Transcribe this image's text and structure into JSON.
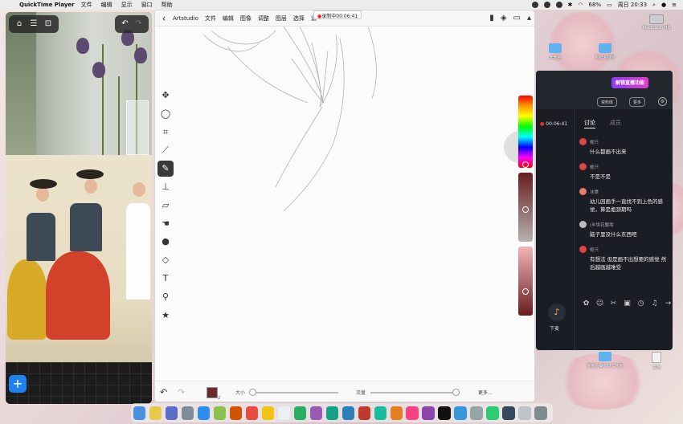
{
  "menubar": {
    "app_name": "QuickTime Player",
    "items": [
      "文件",
      "编辑",
      "显示",
      "窗口",
      "帮助"
    ],
    "battery": "68%",
    "clock": "周日 20:33"
  },
  "desktop": {
    "icons": [
      {
        "label": "Macintosh HD",
        "kind": "drive"
      },
      {
        "label": "未命名",
        "kind": "folder"
      },
      {
        "label": "贴纸素材包",
        "kind": "folder"
      },
      {
        "label": "画画临摹资料文件夹",
        "kind": "folder"
      },
      {
        "label": "文档",
        "kind": "doc"
      }
    ]
  },
  "artstudio": {
    "menu": [
      "Artstudio",
      "文件",
      "编辑",
      "图像",
      "调整",
      "图层",
      "选择",
      "滤"
    ],
    "recording": "录制中00:06:41",
    "brush_size_label": "大小",
    "flow_label": "流量",
    "more_label": "更多...",
    "swatch_number": "2",
    "brush_size_fraction": 0.03,
    "flow_fraction": 0.97,
    "current_color": "#6a2a2c",
    "tools": [
      "move-icon",
      "lasso-icon",
      "crop-icon",
      "eyedropper-icon",
      "brush-icon",
      "stamp-icon",
      "eraser-icon",
      "smudge-icon",
      "blur-icon",
      "fill-icon",
      "text-icon",
      "zoom-icon",
      "star-icon"
    ],
    "active_tool": "brush-icon"
  },
  "live": {
    "badge": "解锁直播功能",
    "btn_library": "资料库",
    "btn_more": "更多",
    "timer": "00:06:41",
    "tab_discuss": "讨论",
    "tab_members": "成员",
    "messages": [
      {
        "user": "栀只",
        "text": "什么都画不出来"
      },
      {
        "user": "栀只",
        "text": "不是不是"
      },
      {
        "user": "冰棠",
        "text": "幼儿园画手一直找不到上色的感觉，算是瓶颈期吗"
      },
      {
        "user": "(半世花飘零",
        "text": "脑子里没什么东西吧"
      },
      {
        "user": "栀只",
        "text": "有想法 但是画不出想要的感觉 然后越画越难受"
      }
    ],
    "mic_label": "下麦"
  }
}
